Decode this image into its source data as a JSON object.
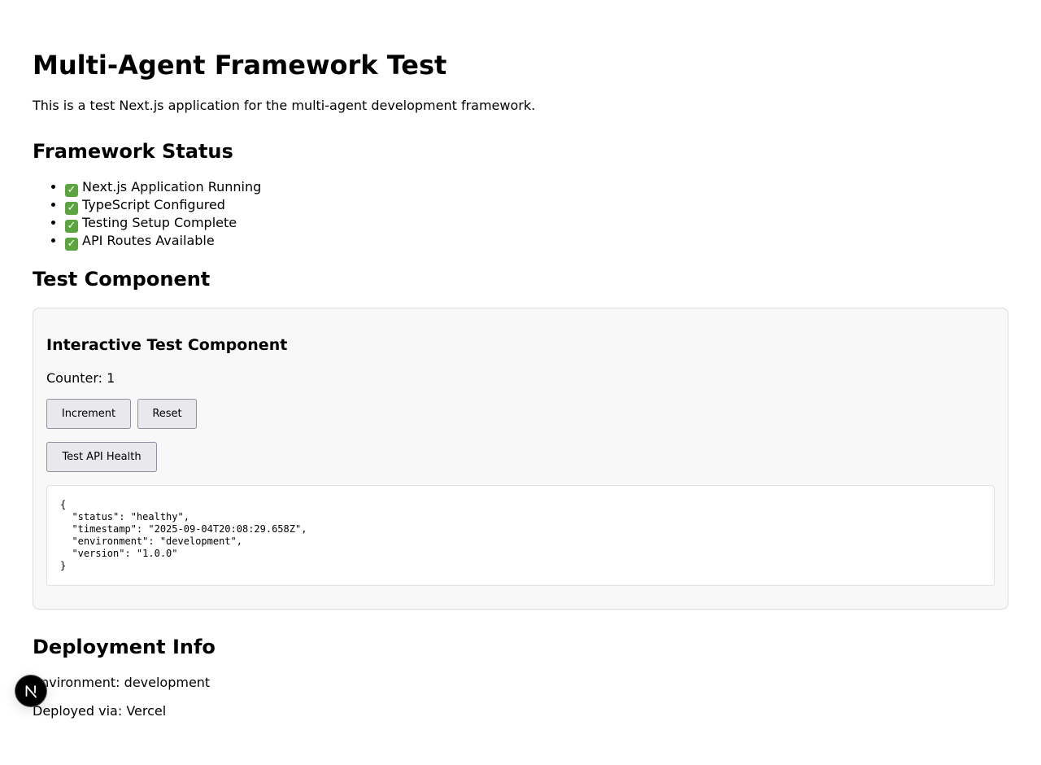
{
  "page": {
    "title": "Multi-Agent Framework Test",
    "intro": "This is a test Next.js application for the multi-agent development framework."
  },
  "status_section": {
    "heading": "Framework Status",
    "items": [
      {
        "icon": "check-mark-icon",
        "label": "Next.js Application Running"
      },
      {
        "icon": "check-mark-icon",
        "label": "TypeScript Configured"
      },
      {
        "icon": "check-mark-icon",
        "label": "Testing Setup Complete"
      },
      {
        "icon": "check-mark-icon",
        "label": "API Routes Available"
      }
    ]
  },
  "test_section": {
    "heading": "Test Component",
    "card_title": "Interactive Test Component",
    "counter_label": "Counter:",
    "counter_value": "1",
    "increment_label": "Increment",
    "reset_label": "Reset",
    "health_label": "Test API Health",
    "health_response": "{\n  \"status\": \"healthy\",\n  \"timestamp\": \"2025-09-04T20:08:29.658Z\",\n  \"environment\": \"development\",\n  \"version\": \"1.0.0\"\n}"
  },
  "deploy_section": {
    "heading": "Deployment Info",
    "environment_label": "Environment:",
    "environment_value": "development",
    "deployed_via_label": "Deployed via:",
    "deployed_via_value": "Vercel"
  },
  "dev_indicator": {
    "icon": "nextjs-logo-icon",
    "letter": "N"
  },
  "colors": {
    "check_green": "#5ba43f",
    "card_background": "#f8f8f8",
    "button_background": "#e9e9ed"
  }
}
